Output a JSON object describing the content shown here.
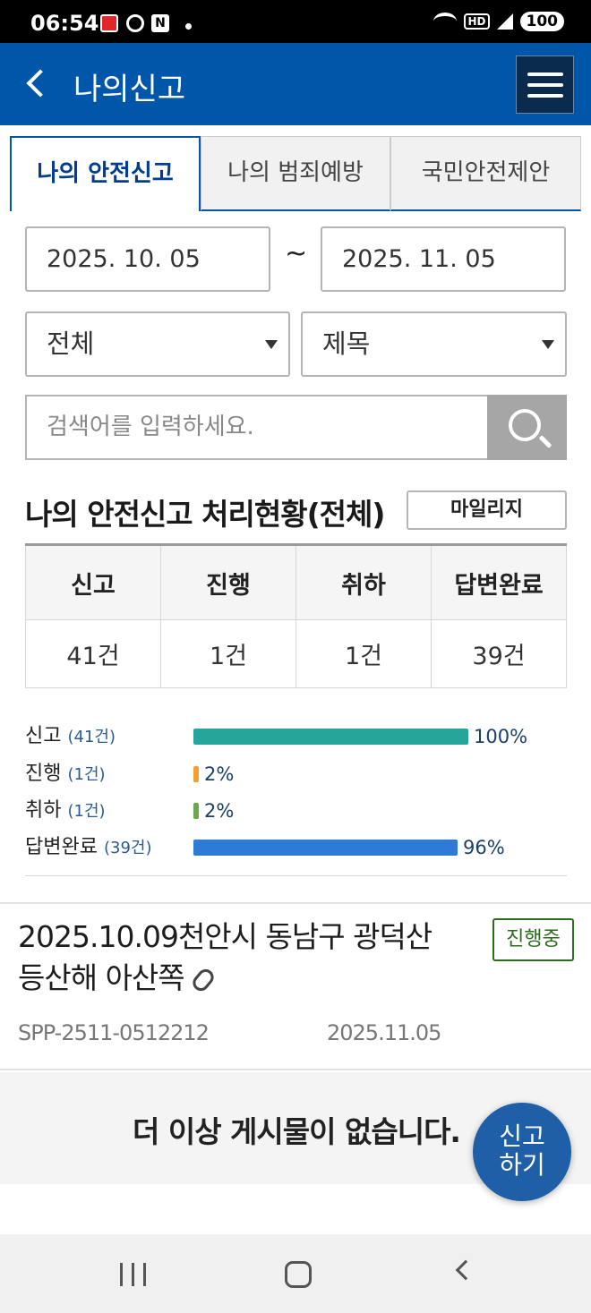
{
  "status_bar": {
    "time": "06:54",
    "battery": "100",
    "hd": "HD",
    "notif_icon_label": "N"
  },
  "header": {
    "title": "나의신고",
    "back_icon": "chevron-left-icon",
    "menu_icon": "hamburger-menu-icon",
    "color": "#0056a8"
  },
  "tabs": [
    {
      "label": "나의 안전신고",
      "active": true
    },
    {
      "label": "나의 범죄예방",
      "active": false
    },
    {
      "label": "국민안전제안",
      "active": false
    }
  ],
  "filters": {
    "start_date": "2025. 10. 05",
    "range_sep": "~",
    "end_date": "2025. 11. 05",
    "category": "전체",
    "field": "제목",
    "search_placeholder": "검색어를 입력하세요."
  },
  "summary": {
    "title": "나의 안전신고 처리현황(전체)",
    "mileage_button": "마일리지",
    "headers": [
      "신고",
      "진행",
      "취하",
      "답변완료"
    ],
    "values": [
      "41건",
      "1건",
      "1건",
      "39건"
    ]
  },
  "progress": [
    {
      "label": "신고",
      "count": "(41건)",
      "percent": 100,
      "percent_label": "100%",
      "color": "#26a69a"
    },
    {
      "label": "진행",
      "count": "(1건)",
      "percent": 2,
      "percent_label": "2%",
      "color": "#f0a030"
    },
    {
      "label": "취하",
      "count": "(1건)",
      "percent": 2,
      "percent_label": "2%",
      "color": "#6aa84f"
    },
    {
      "label": "답변완료",
      "count": "(39건)",
      "percent": 96,
      "percent_label": "96%",
      "color": "#2e7bd6"
    }
  ],
  "posts": [
    {
      "title_line1": "2025.10.09천안시 동남구 광덕산",
      "title_line2": "등산해 아산쪽",
      "attachment_icon": "paperclip-icon",
      "status": "진행중",
      "id": "SPP-2511-0512212",
      "date": "2025.11.05"
    }
  ],
  "no_more": "더 이상 게시물이 없습니다.",
  "fab": {
    "line1": "신고",
    "line2": "하기"
  }
}
